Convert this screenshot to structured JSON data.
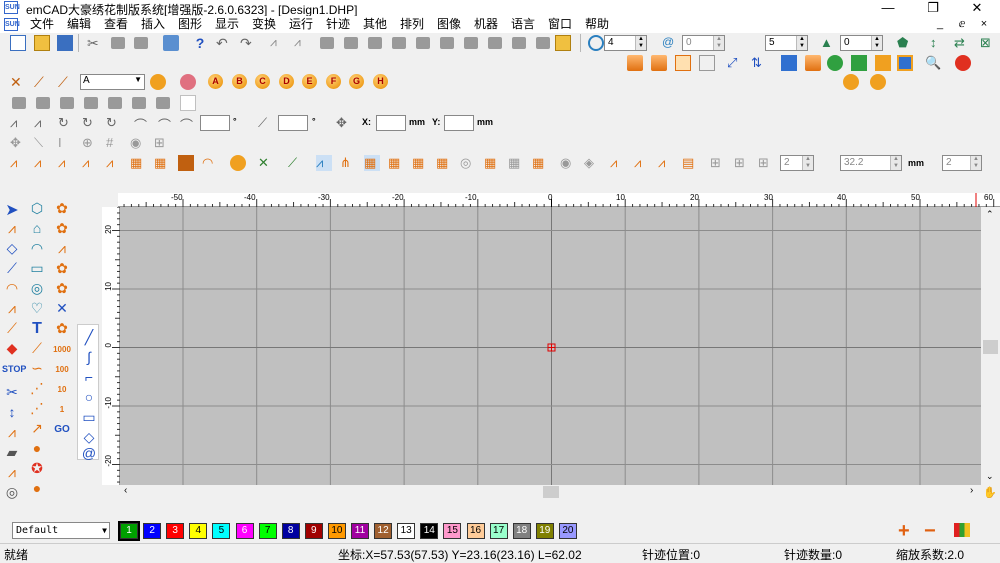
{
  "app": {
    "title": "emCAD大豪绣花制版系统[增强版-2.6.0.6323] - [Design1.DHP]",
    "logo_text": "SUN",
    "minimize": "—",
    "restore": "❐",
    "close": "✕"
  },
  "menu": {
    "items": [
      "文件",
      "编辑",
      "查看",
      "插入",
      "图形",
      "显示",
      "变换",
      "运行",
      "针迹",
      "其他",
      "排列",
      "图像",
      "机器",
      "语言",
      "窗口",
      "帮助"
    ],
    "win_min": "_",
    "win_restore": "ⅇ",
    "win_close": "×"
  },
  "toolbar1": {
    "num_left": "4",
    "num_left_dim": "0",
    "num_right": "5",
    "num_right2": "0"
  },
  "toolbar4": {
    "deg1_unit": "°",
    "deg2_unit": "°",
    "x_label": "X:",
    "y_label": "Y:",
    "x_unit": "mm",
    "y_unit": "mm"
  },
  "toolbar2": {
    "font_select": "A",
    "letters": [
      "A",
      "B",
      "C",
      "D",
      "E",
      "F",
      "G",
      "H"
    ]
  },
  "toolbar6": {
    "val1": "2",
    "val2": "32.2",
    "unit": "mm",
    "val3": "2"
  },
  "ruler": {
    "h_labels": [
      "-50",
      "-40",
      "-30",
      "-20",
      "-10",
      "0",
      "10",
      "20",
      "30",
      "40",
      "50",
      "60"
    ],
    "v_labels": [
      "20",
      "10",
      "0",
      "-10",
      "-20"
    ]
  },
  "left": {
    "stop_label": "STOP",
    "go_label": "GO",
    "text_tool": "T",
    "n1000": "1000",
    "n100": "100",
    "n10": "10",
    "n1": "1"
  },
  "palette": {
    "style_name": "Default",
    "colors": [
      {
        "n": "1",
        "c": "#00a000",
        "fg": "#fff"
      },
      {
        "n": "2",
        "c": "#0000ff",
        "fg": "#fff"
      },
      {
        "n": "3",
        "c": "#ff0000",
        "fg": "#fff"
      },
      {
        "n": "4",
        "c": "#ffff00",
        "fg": "#000"
      },
      {
        "n": "5",
        "c": "#00ffff",
        "fg": "#000"
      },
      {
        "n": "6",
        "c": "#ff00ff",
        "fg": "#fff"
      },
      {
        "n": "7",
        "c": "#00ff00",
        "fg": "#000"
      },
      {
        "n": "8",
        "c": "#0000a0",
        "fg": "#fff"
      },
      {
        "n": "9",
        "c": "#a00000",
        "fg": "#fff"
      },
      {
        "n": "10",
        "c": "#ff9900",
        "fg": "#000"
      },
      {
        "n": "11",
        "c": "#a000a0",
        "fg": "#fff"
      },
      {
        "n": "12",
        "c": "#a06030",
        "fg": "#fff"
      },
      {
        "n": "13",
        "c": "#ffffff",
        "fg": "#000"
      },
      {
        "n": "14",
        "c": "#000000",
        "fg": "#fff"
      },
      {
        "n": "15",
        "c": "#ff99cc",
        "fg": "#000"
      },
      {
        "n": "16",
        "c": "#ffcc99",
        "fg": "#000"
      },
      {
        "n": "17",
        "c": "#99ffcc",
        "fg": "#000"
      },
      {
        "n": "18",
        "c": "#808080",
        "fg": "#fff"
      },
      {
        "n": "19",
        "c": "#808000",
        "fg": "#fff"
      },
      {
        "n": "20",
        "c": "#9999ff",
        "fg": "#000"
      }
    ],
    "add": "+",
    "remove": "−"
  },
  "status": {
    "ready": "就绪",
    "coords": "坐标:X=57.53(57.53) Y=23.16(23.16) L=62.02",
    "stitch_pos": "针迹位置:0",
    "stitch_count": "针迹数量:0",
    "zoom": "缩放系数:2.0"
  }
}
